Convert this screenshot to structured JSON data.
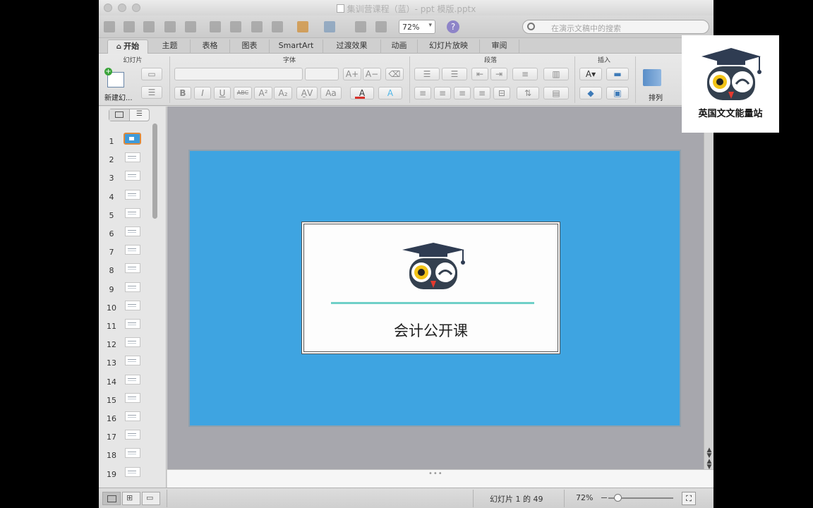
{
  "window": {
    "title": "集训营课程（蓝）- ppt 模版.pptx"
  },
  "toolbar": {
    "zoom_value": "72%",
    "help_glyph": "?",
    "search_placeholder": "在演示文稿中的搜索"
  },
  "ribbon": {
    "tabs": [
      {
        "label": "开始",
        "active": true
      },
      {
        "label": "主题"
      },
      {
        "label": "表格"
      },
      {
        "label": "图表"
      },
      {
        "label": "SmartArt"
      },
      {
        "label": "过渡效果"
      },
      {
        "label": "动画"
      },
      {
        "label": "幻灯片放映"
      },
      {
        "label": "审阅"
      }
    ],
    "groups": {
      "slides": "幻灯片",
      "font": "字体",
      "paragraph": "段落",
      "insert": "插入"
    },
    "buttons": {
      "new_slide": "新建幻...",
      "arrange": "排列",
      "bold": "B",
      "italic": "I",
      "underline": "U",
      "strike": "ABC",
      "superscript": "A²",
      "subscript": "A₂",
      "grow_font": "A+",
      "shrink_font": "A−",
      "font_color": "A",
      "text_effect": "A"
    }
  },
  "slides_panel": {
    "numbers": [
      "1",
      "2",
      "3",
      "4",
      "5",
      "6",
      "7",
      "8",
      "9",
      "10",
      "11",
      "12",
      "13",
      "14",
      "15",
      "16",
      "17",
      "18",
      "19"
    ],
    "selected": 1
  },
  "slide": {
    "background_color": "#3ea4e1",
    "card_title": "会计公开课",
    "accent_line_color": "#6fd0c8",
    "logo": "owl-graduation-cap-icon"
  },
  "statusbar": {
    "slide_status": "幻灯片 1 的 49",
    "zoom": "72%",
    "zoom_fraction": 0.15
  },
  "watermark": {
    "text": "英国文文能量站",
    "logo": "owl-graduation-cap-icon"
  }
}
